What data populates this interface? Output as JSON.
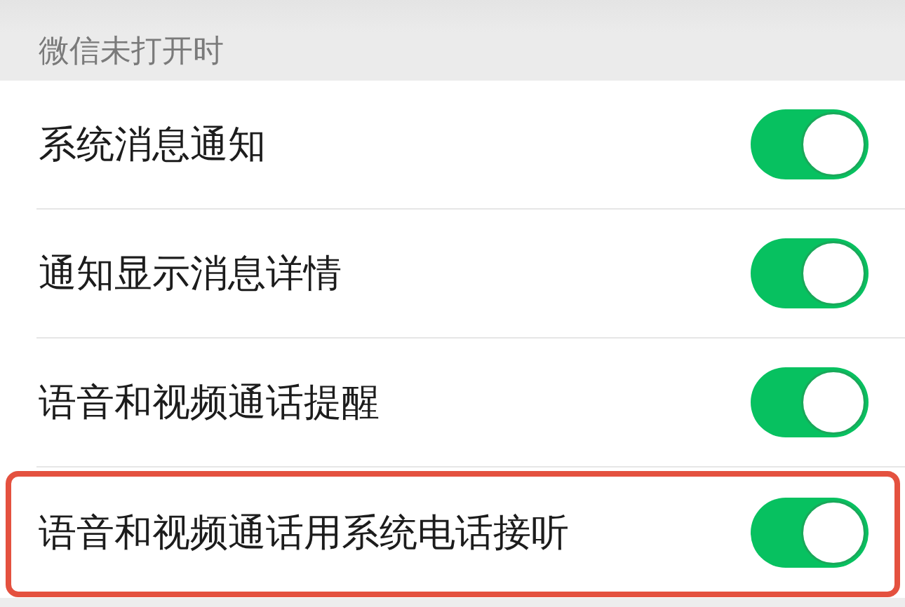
{
  "section_header": {
    "title": "微信未打开时"
  },
  "rows": [
    {
      "label": "系统消息通知",
      "on": true,
      "highlighted": false
    },
    {
      "label": "通知显示消息详情",
      "on": true,
      "highlighted": false
    },
    {
      "label": "语音和视频通话提醒",
      "on": true,
      "highlighted": false
    },
    {
      "label": "语音和视频通话用系统电话接听",
      "on": true,
      "highlighted": true
    }
  ]
}
